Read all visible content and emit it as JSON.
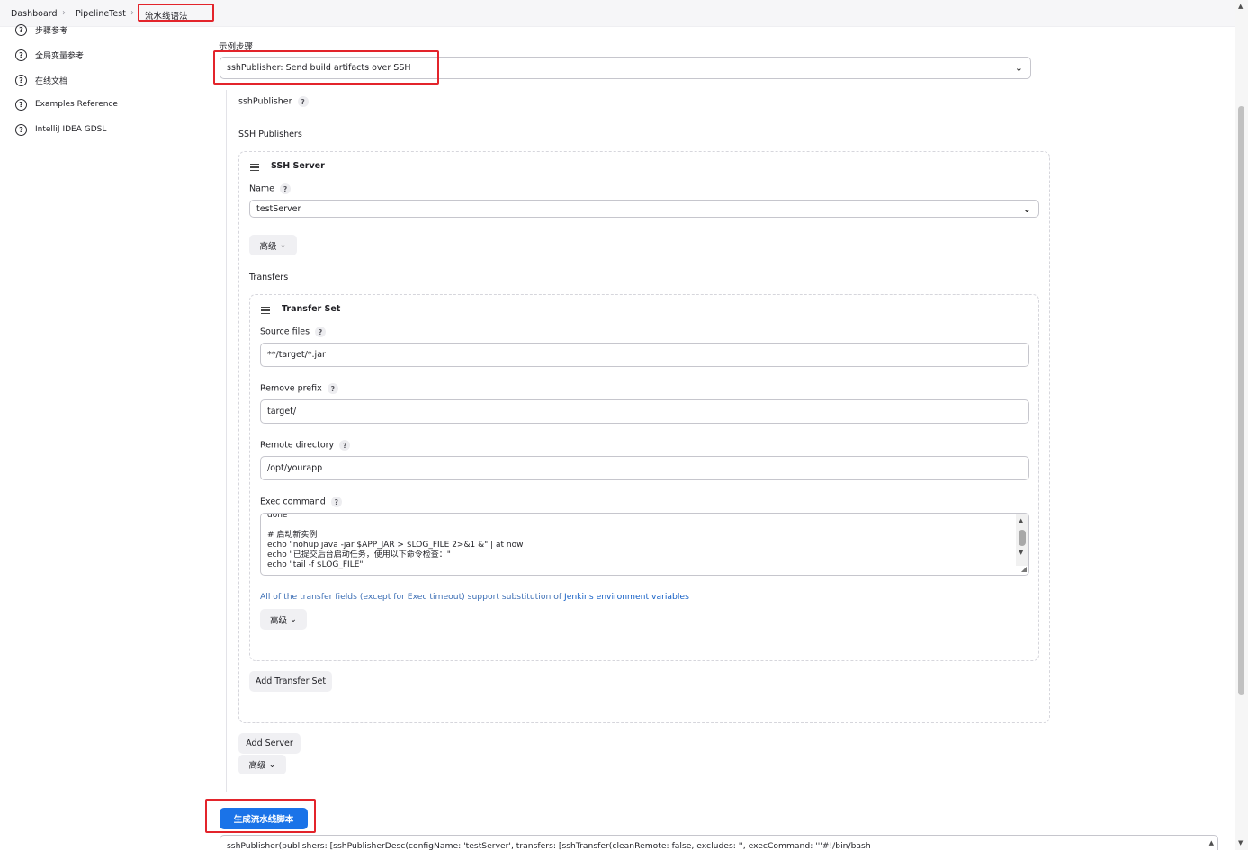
{
  "breadcrumb": {
    "items": [
      "Dashboard",
      "PipelineTest",
      "流水线语法"
    ],
    "separator": "›"
  },
  "sidebar": {
    "items": [
      {
        "label": "步骤参考",
        "icon": "help-icon"
      },
      {
        "label": "全局变量参考",
        "icon": "help-icon"
      },
      {
        "label": "在线文档",
        "icon": "help-icon"
      },
      {
        "label": "Examples Reference",
        "icon": "help-icon"
      },
      {
        "label": "IntelliJ IDEA GDSL",
        "icon": "help-icon"
      }
    ]
  },
  "main": {
    "sample_step_label": "示例步骤",
    "sample_step_value": "sshPublisher: Send build artifacts over SSH",
    "ssh_publisher_label": "sshPublisher",
    "ssh_publishers_label": "SSH Publishers",
    "ssh_server": {
      "title": "SSH Server",
      "name_label": "Name",
      "name_value": "testServer",
      "advanced_label": "高级",
      "transfers_label": "Transfers",
      "transfer_set": {
        "title": "Transfer Set",
        "source_files_label": "Source files",
        "source_files_value": "**/target/*.jar",
        "remove_prefix_label": "Remove prefix",
        "remove_prefix_value": "target/",
        "remote_directory_label": "Remote directory",
        "remote_directory_value": "/opt/yourapp",
        "exec_command_label": "Exec command",
        "exec_command_lines": [
          "done",
          "",
          "# 启动新实例",
          "echo \"nohup java -jar $APP_JAR > $LOG_FILE 2>&1 &\" | at now",
          "echo \"已提交后台启动任务，使用以下命令检查：\"",
          "echo \"tail -f $LOG_FILE\""
        ],
        "note_text": "All of the transfer fields (except for Exec timeout) support substitution of ",
        "note_link": "Jenkins environment variables",
        "advanced_label": "高级"
      },
      "add_transfer_set_label": "Add Transfer Set"
    },
    "add_server_label": "Add Server",
    "advanced_label": "高级",
    "generate_button_label": "生成流水线脚本",
    "output_script": "sshPublisher(publishers: [sshPublisherDesc(configName: 'testServer', transfers: [sshTransfer(cleanRemote: false, excludes: '', execCommand: '''#!/bin/bash"
  },
  "colors": {
    "primary": "#1a73e8",
    "highlight": "#e3242b"
  }
}
